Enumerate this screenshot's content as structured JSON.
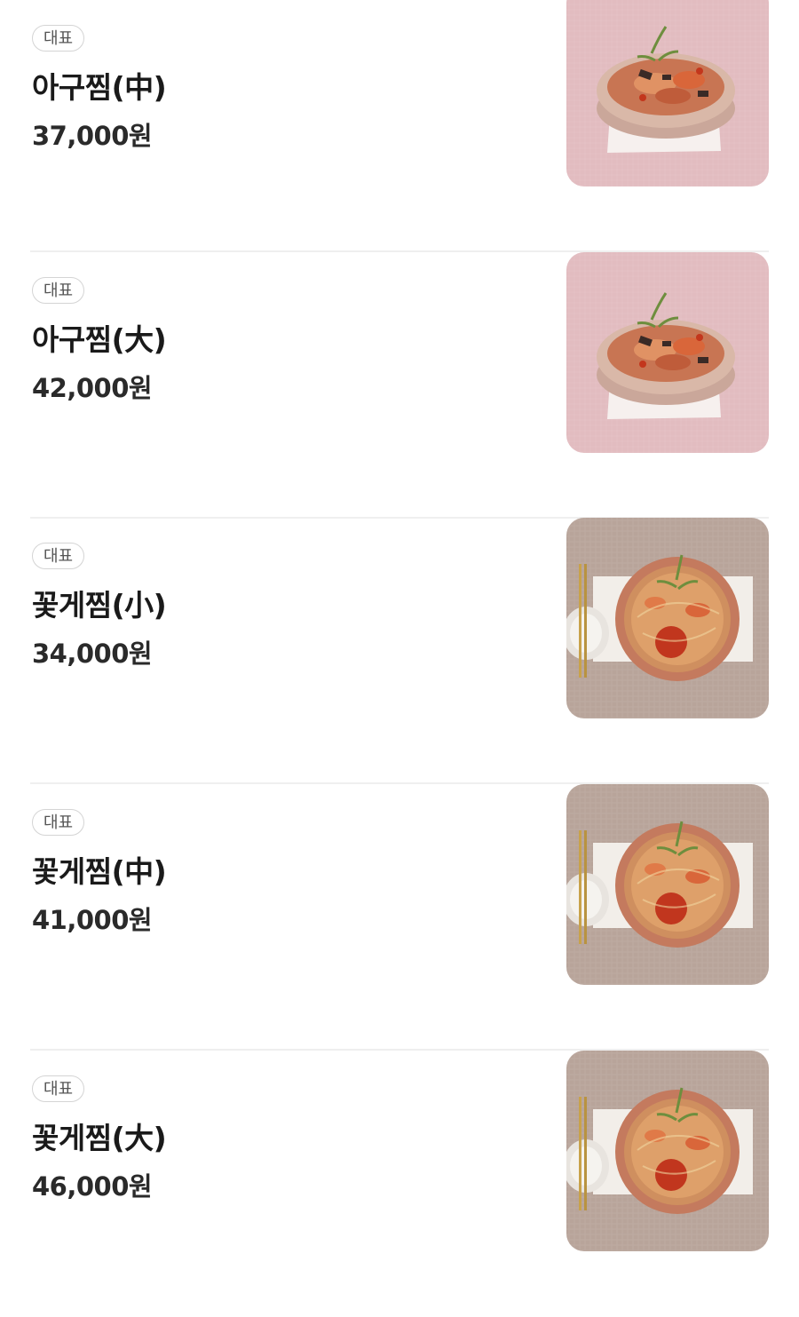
{
  "menu": {
    "items": [
      {
        "badge": "대표",
        "name": "아구찜(中)",
        "price": "37,000원",
        "photo": "monkfish-dish-photo"
      },
      {
        "badge": "대표",
        "name": "아구찜(大)",
        "price": "42,000원",
        "photo": "monkfish-dish-photo"
      },
      {
        "badge": "대표",
        "name": "꽃게찜(小)",
        "price": "34,000원",
        "photo": "crab-dish-photo"
      },
      {
        "badge": "대표",
        "name": "꽃게찜(中)",
        "price": "41,000원",
        "photo": "crab-dish-photo"
      },
      {
        "badge": "대표",
        "name": "꽃게찜(大)",
        "price": "46,000원",
        "photo": "crab-dish-photo"
      }
    ]
  },
  "colors": {
    "monkfish_bg": "#e2bcc0",
    "crab_bg": "#b8a49a",
    "divider": "#efefef",
    "badge_border": "#d4d4d4"
  }
}
